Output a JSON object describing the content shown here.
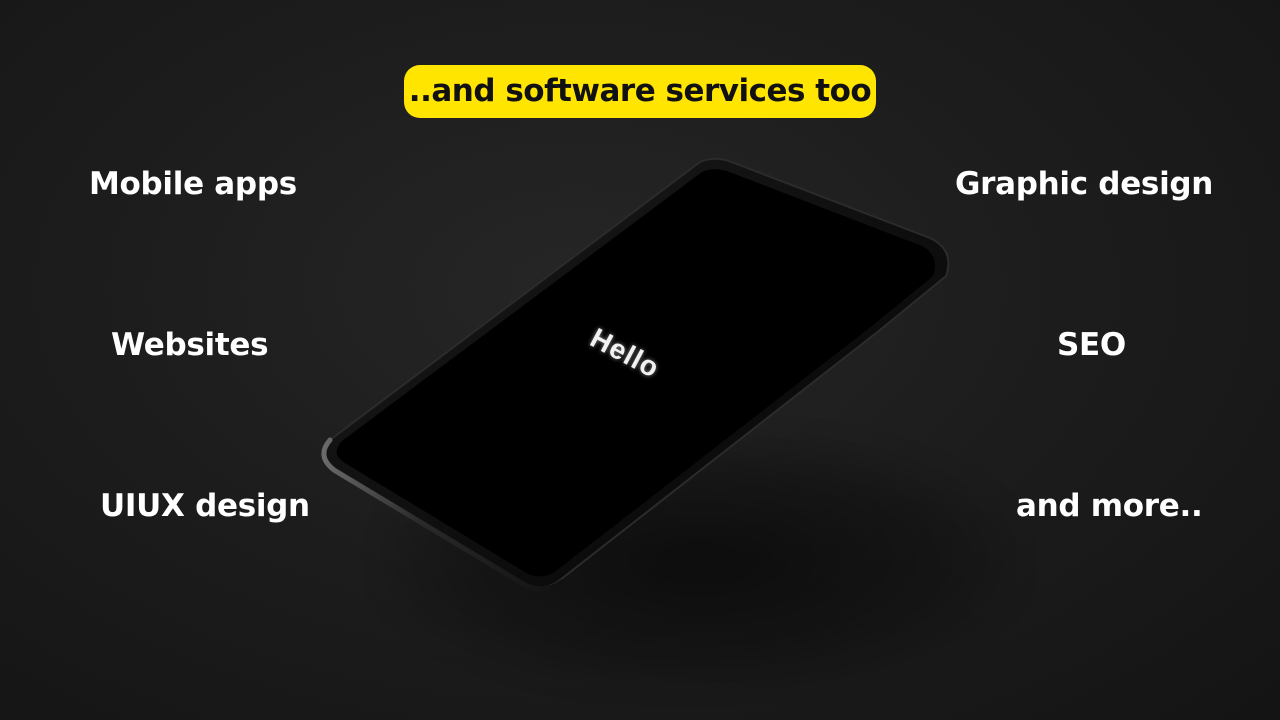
{
  "headline": "..and software services too",
  "phone": {
    "screen_text": "Hello"
  },
  "services_left": [
    "Mobile apps",
    "Websites",
    "UIUX design"
  ],
  "services_right": [
    "Graphic design",
    "SEO",
    "and more.."
  ],
  "colors": {
    "accent": "#ffe500",
    "text": "#ffffff",
    "background": "#1d1d1d"
  }
}
